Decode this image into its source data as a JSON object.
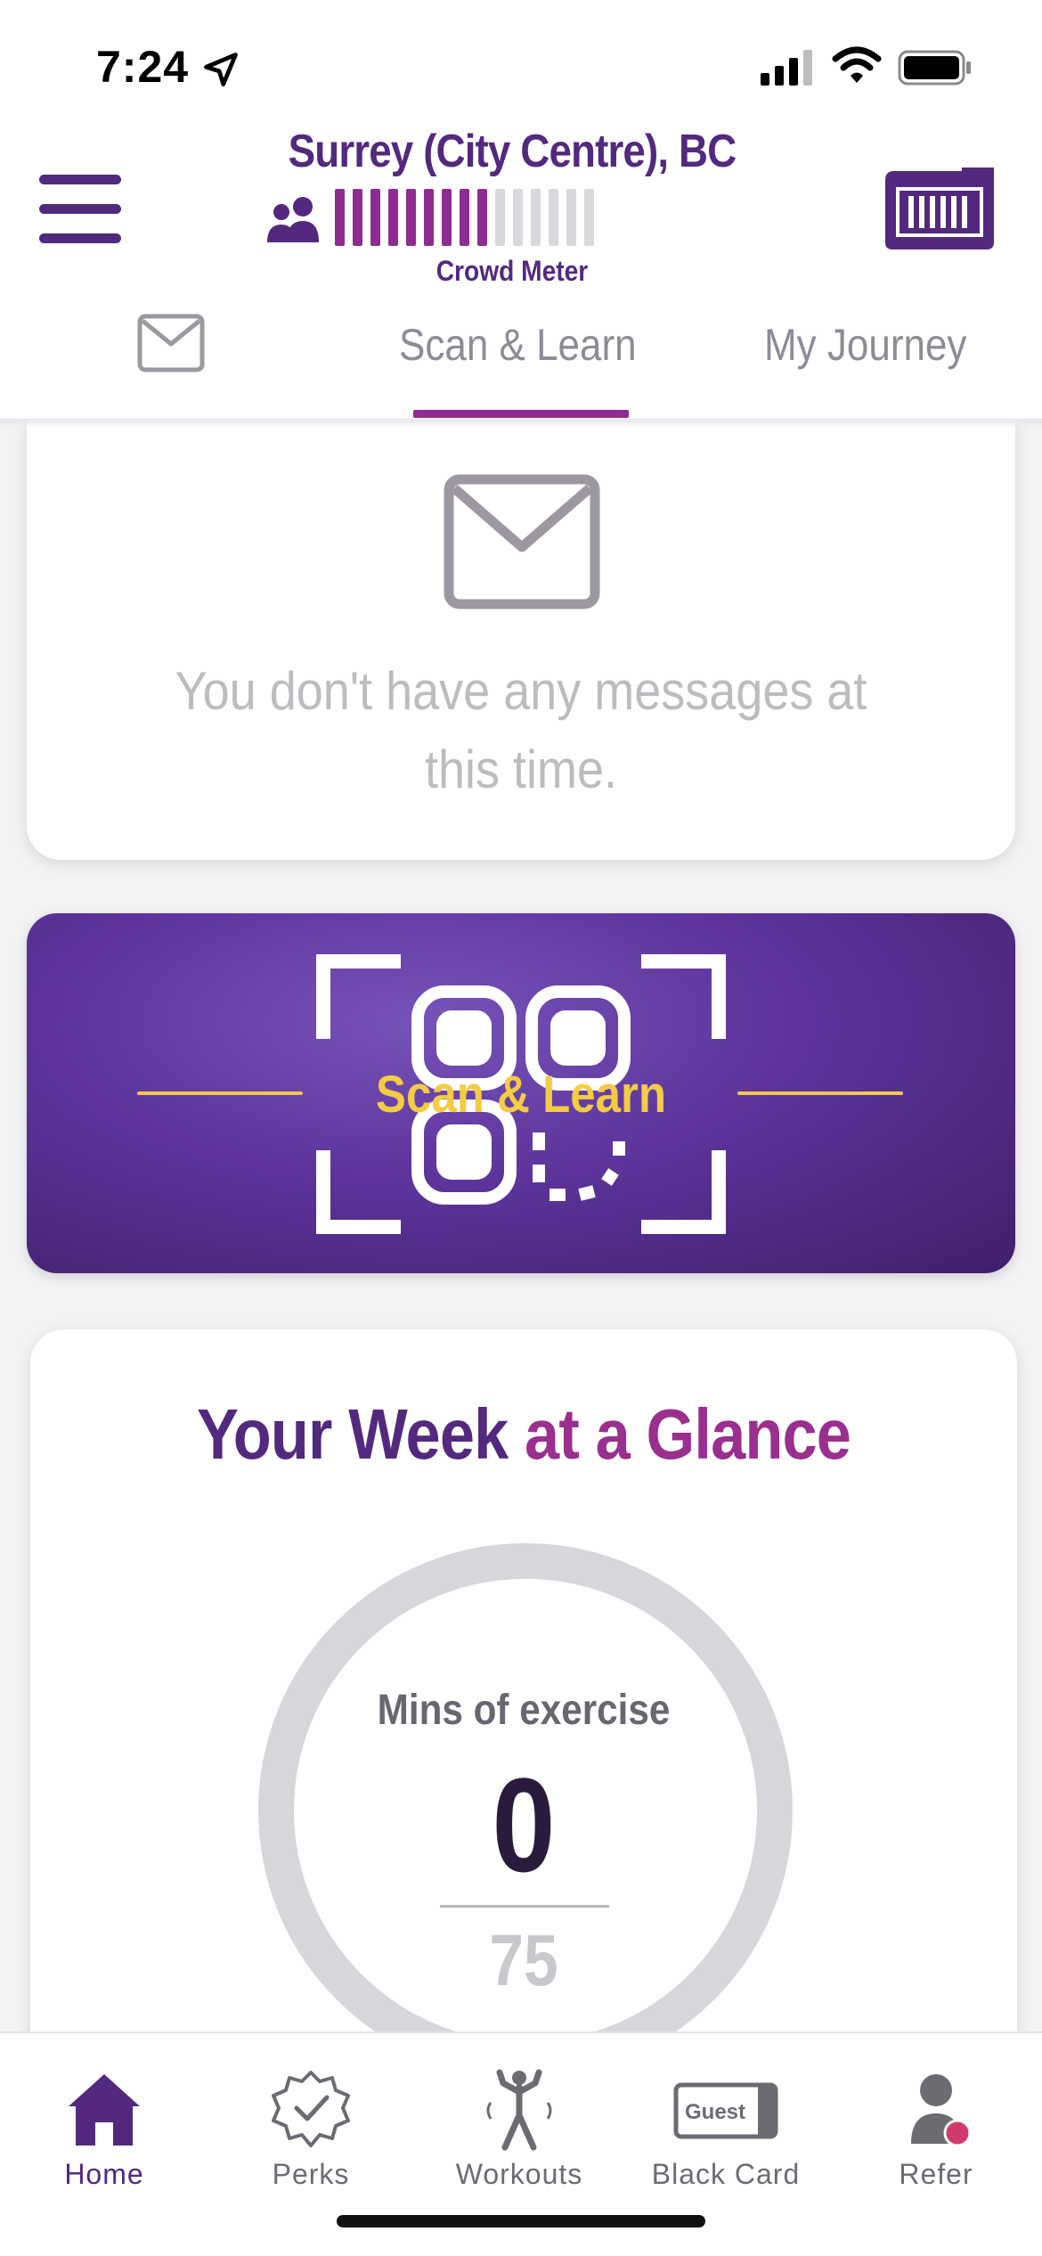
{
  "status_bar": {
    "time": "7:24"
  },
  "header": {
    "club_name": "Surrey (City Centre), BC",
    "crowd_meter": {
      "label": "Crowd Meter",
      "level": 0.6,
      "filled_color": "#8e2c92",
      "empty_color": "#d9d8dc"
    }
  },
  "tabs": {
    "items": [
      {
        "label": "Scan & Learn",
        "active": true
      },
      {
        "label": "My Journey",
        "active": false
      }
    ]
  },
  "messages": {
    "empty_text": "You don't have any messages at this time."
  },
  "scan_banner": {
    "label": "Scan & Learn"
  },
  "week_glance": {
    "title_part1": "Your Week",
    "title_part2": " at a Glance",
    "metric_label": "Mins of exercise",
    "value": "0",
    "goal": "75"
  },
  "bottom_nav": {
    "items": [
      {
        "label": "Home",
        "icon": "home-icon",
        "active": true
      },
      {
        "label": "Perks",
        "icon": "perks-badge-icon",
        "active": false
      },
      {
        "label": "Workouts",
        "icon": "workouts-icon",
        "active": false
      },
      {
        "label": "Black Card",
        "icon": "black-card-guest-icon",
        "active": false
      },
      {
        "label": "Refer",
        "icon": "refer-person-icon",
        "active": false
      }
    ],
    "guest_card_text": "Guest"
  },
  "colors": {
    "brand_purple": "#53297f",
    "accent_magenta": "#8e2c92",
    "scan_yellow": "#f4cc44"
  }
}
